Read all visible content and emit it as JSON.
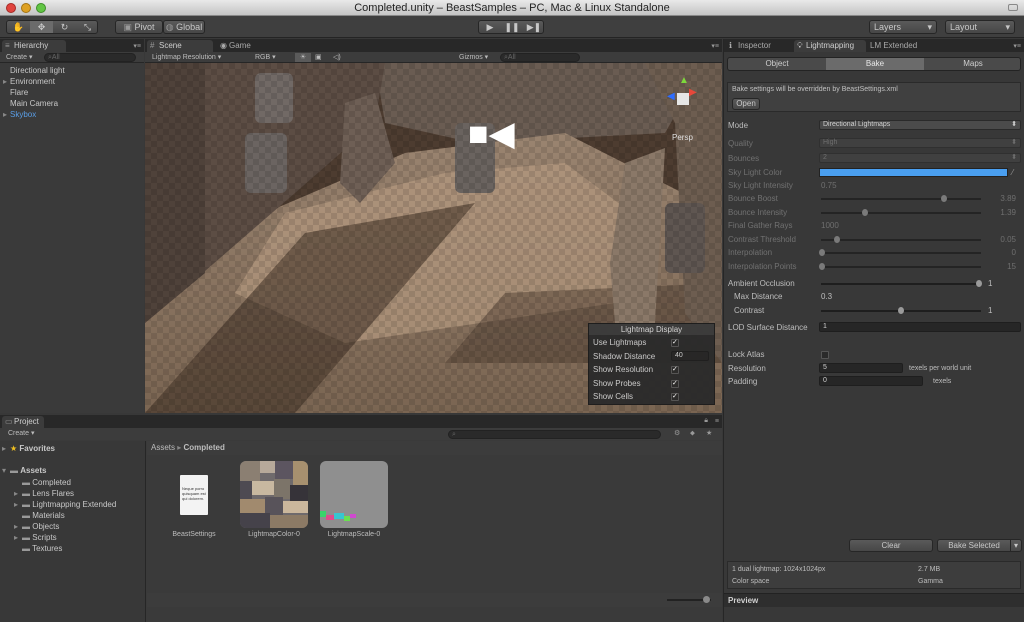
{
  "window": {
    "title": "Completed.unity – BeastSamples – PC, Mac & Linux Standalone"
  },
  "toolbar": {
    "pivot": "Pivot",
    "global": "Global",
    "layers": "Layers",
    "layout": "Layout"
  },
  "hierarchy": {
    "tab": "Hierarchy",
    "create": "Create ▾",
    "search": "All",
    "items": [
      "Directional light",
      "Environment",
      "Flare",
      "Main Camera",
      "Skybox"
    ]
  },
  "scene": {
    "tab_scene": "Scene",
    "tab_game": "Game",
    "render_mode": "Lightmap Resolution",
    "color_mode": "RGB",
    "gizmos": "Gizmos ▾",
    "search": "All",
    "persp": "Persp"
  },
  "lightmap_display": {
    "title": "Lightmap Display",
    "use_lightmaps": "Use Lightmaps",
    "shadow_distance": "Shadow Distance",
    "shadow_distance_value": "40",
    "show_resolution": "Show Resolution",
    "show_probes": "Show Probes",
    "show_cells": "Show Cells"
  },
  "project": {
    "tab": "Project",
    "create": "Create ▾",
    "favorites": "Favorites",
    "assets": "Assets",
    "folders": [
      "Completed",
      "Lens Flares",
      "Lightmapping Extended",
      "Materials",
      "Objects",
      "Scripts",
      "Textures"
    ],
    "breadcrumb_root": "Assets",
    "breadcrumb_sep": "▸",
    "breadcrumb_current": "Completed",
    "files": [
      {
        "name": "BeastSettings",
        "doc_text": "Neque porro quisquam est qui dolorem."
      },
      {
        "name": "LightmapColor-0"
      },
      {
        "name": "LightmapScale-0"
      }
    ]
  },
  "inspector": {
    "tab_inspector": "Inspector",
    "tab_lightmapping": "Lightmapping",
    "tab_lm_extended": "LM Extended",
    "seg_object": "Object",
    "seg_bake": "Bake",
    "seg_maps": "Maps",
    "notice": "Bake settings will be overridden by BeastSettings.xml",
    "open": "Open",
    "mode_label": "Mode",
    "mode_value": "Directional Lightmaps",
    "quality_label": "Quality",
    "quality_value": "High",
    "bounces_label": "Bounces",
    "bounces_value": "2",
    "sky_color_label": "Sky Light Color",
    "sky_color": "#4a9ff0",
    "sky_intensity_label": "Sky Light Intensity",
    "sky_intensity_value": "0.75",
    "bounce_boost_label": "Bounce Boost",
    "bounce_boost_value": "3.89",
    "bounce_intensity_label": "Bounce Intensity",
    "bounce_intensity_value": "1.39",
    "final_gather_label": "Final Gather Rays",
    "final_gather_value": "1000",
    "contrast_threshold_label": "Contrast Threshold",
    "contrast_threshold_value": "0.05",
    "interpolation_label": "Interpolation",
    "interpolation_value": "0",
    "interp_points_label": "Interpolation Points",
    "interp_points_value": "15",
    "ao_label": "Ambient Occlusion",
    "ao_value": "1",
    "max_distance_label": "Max Distance",
    "max_distance_value": "0.3",
    "contrast_label": "Contrast",
    "contrast_value": "1",
    "lod_label": "LOD Surface Distance",
    "lod_value": "1",
    "lock_atlas_label": "Lock Atlas",
    "resolution_label": "Resolution",
    "resolution_value": "5",
    "resolution_unit": "texels per world unit",
    "padding_label": "Padding",
    "padding_value": "0",
    "padding_unit": "texels",
    "clear": "Clear",
    "bake_selected": "Bake Selected",
    "info_lightmap": "1 dual lightmap: 1024x1024px",
    "info_size": "2.7 MB",
    "info_colorspace_label": "Color space",
    "info_colorspace_value": "Gamma",
    "preview": "Preview"
  }
}
